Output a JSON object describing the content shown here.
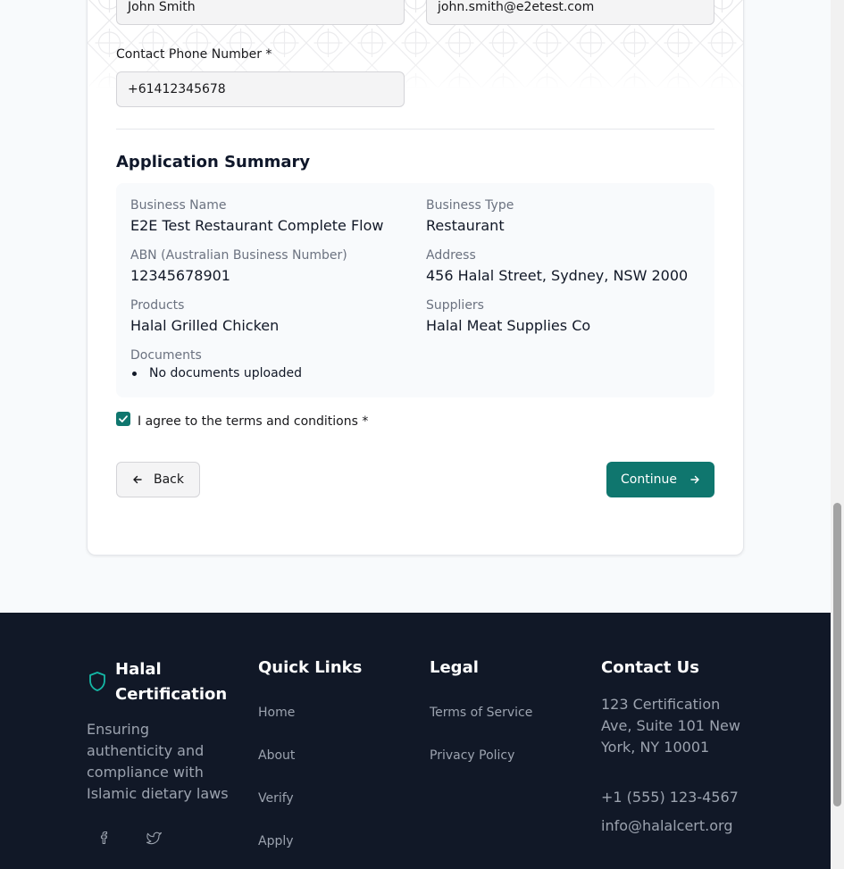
{
  "form": {
    "name_value": "John Smith",
    "email_value": "john.smith@e2etest.com",
    "phone_label": "Contact Phone Number *",
    "phone_value": "+61412345678"
  },
  "summary": {
    "heading": "Application Summary",
    "fields": {
      "business_name_label": "Business Name",
      "business_name_value": "E2E Test Restaurant Complete Flow",
      "business_type_label": "Business Type",
      "business_type_value": "Restaurant",
      "abn_label": "ABN (Australian Business Number)",
      "abn_value": "12345678901",
      "address_label": "Address",
      "address_value": "456 Halal Street, Sydney, NSW 2000",
      "products_label": "Products",
      "products_value": "Halal Grilled Chicken",
      "suppliers_label": "Suppliers",
      "suppliers_value": "Halal Meat Supplies Co",
      "documents_label": "Documents",
      "documents_item": "No documents uploaded"
    }
  },
  "terms": {
    "label": "I agree to the terms and conditions *",
    "checked": true
  },
  "actions": {
    "back_label": "Back",
    "continue_label": "Continue"
  },
  "footer": {
    "brand": "Halal Certification",
    "description": "Ensuring authenticity and compliance with Islamic dietary laws",
    "quick_links_heading": "Quick Links",
    "quick_links": [
      "Home",
      "About",
      "Verify",
      "Apply"
    ],
    "legal_heading": "Legal",
    "legal_links": [
      "Terms of Service",
      "Privacy Policy"
    ],
    "contact_heading": "Contact Us",
    "address": "123 Certification Ave, Suite 101 New York, NY 10001",
    "phone": "+1 (555) 123-4567",
    "email": "info@halalcert.org",
    "social_icons": [
      "facebook-icon",
      "twitter-icon"
    ]
  },
  "colors": {
    "accent": "#0f766e",
    "footer_bg": "#111827"
  }
}
